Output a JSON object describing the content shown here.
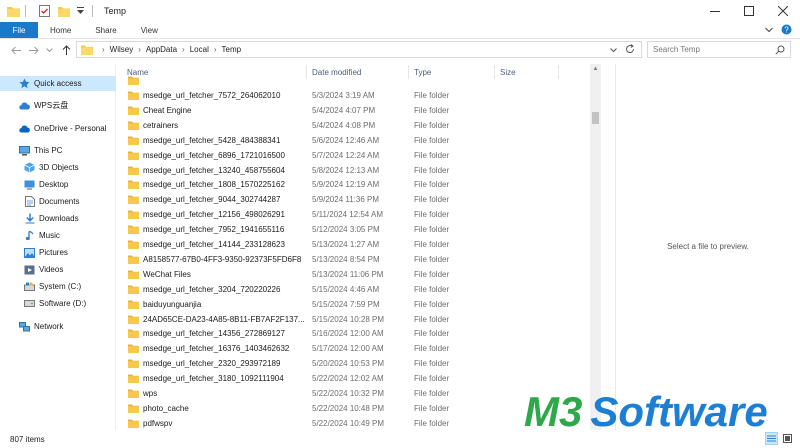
{
  "window": {
    "title": "Temp",
    "minimize_icon": "minimize-icon",
    "maximize_icon": "maximize-icon",
    "close_icon": "close-icon"
  },
  "ribbon": {
    "tabs": [
      {
        "label": "File"
      },
      {
        "label": "Home"
      },
      {
        "label": "Share"
      },
      {
        "label": "View"
      }
    ],
    "accent": "#1979ca"
  },
  "address": {
    "crumbs": [
      "Wilsey",
      "AppData",
      "Local",
      "Temp"
    ]
  },
  "search": {
    "placeholder": "Search Temp"
  },
  "navpane": {
    "quick_access": "Quick access",
    "wps": "WPS云盘",
    "onedrive": "OneDrive - Personal",
    "this_pc": "This PC",
    "items": [
      {
        "label": "3D Objects",
        "icon": "3d-objects-icon"
      },
      {
        "label": "Desktop",
        "icon": "desktop-icon"
      },
      {
        "label": "Documents",
        "icon": "documents-icon"
      },
      {
        "label": "Downloads",
        "icon": "downloads-icon"
      },
      {
        "label": "Music",
        "icon": "music-icon"
      },
      {
        "label": "Pictures",
        "icon": "pictures-icon"
      },
      {
        "label": "Videos",
        "icon": "videos-icon"
      },
      {
        "label": "System (C:)",
        "icon": "drive-c-icon"
      },
      {
        "label": "Software (D:)",
        "icon": "drive-d-icon"
      }
    ],
    "network": "Network"
  },
  "columns": {
    "name": "Name",
    "date": "Date modified",
    "type": "Type",
    "size": "Size"
  },
  "files": [
    {
      "name": "msedge_url_fetcher_7572_264062010",
      "date": "5/3/2024 3:19 AM",
      "type": "File folder"
    },
    {
      "name": "Cheat Engine",
      "date": "5/4/2024 4:07 PM",
      "type": "File folder"
    },
    {
      "name": "cetrainers",
      "date": "5/4/2024 4:08 PM",
      "type": "File folder"
    },
    {
      "name": "msedge_url_fetcher_5428_484388341",
      "date": "5/6/2024 12:46 AM",
      "type": "File folder"
    },
    {
      "name": "msedge_url_fetcher_6896_1721016500",
      "date": "5/7/2024 12:24 AM",
      "type": "File folder"
    },
    {
      "name": "msedge_url_fetcher_13240_458755604",
      "date": "5/8/2024 12:13 AM",
      "type": "File folder"
    },
    {
      "name": "msedge_url_fetcher_1808_1570225162",
      "date": "5/9/2024 12:19 AM",
      "type": "File folder"
    },
    {
      "name": "msedge_url_fetcher_9044_302744287",
      "date": "5/9/2024 11:36 PM",
      "type": "File folder"
    },
    {
      "name": "msedge_url_fetcher_12156_498026291",
      "date": "5/11/2024 12:54 AM",
      "type": "File folder"
    },
    {
      "name": "msedge_url_fetcher_7952_1941655116",
      "date": "5/12/2024 3:05 PM",
      "type": "File folder"
    },
    {
      "name": "msedge_url_fetcher_14144_233128623",
      "date": "5/13/2024 1:27 AM",
      "type": "File folder"
    },
    {
      "name": "A8158577-67B0-4FF3-9350-92373F5FD6F8",
      "date": "5/13/2024 8:54 PM",
      "type": "File folder"
    },
    {
      "name": "WeChat Files",
      "date": "5/13/2024 11:06 PM",
      "type": "File folder"
    },
    {
      "name": "msedge_url_fetcher_3204_720220226",
      "date": "5/15/2024 4:46 AM",
      "type": "File folder"
    },
    {
      "name": "baiduyunguanjia",
      "date": "5/15/2024 7:59 PM",
      "type": "File folder"
    },
    {
      "name": "24AD65CE-DA23-4A85-8B11-FB7AF2F137...",
      "date": "5/15/2024 10:28 PM",
      "type": "File folder"
    },
    {
      "name": "msedge_url_fetcher_14356_272869127",
      "date": "5/16/2024 12:00 AM",
      "type": "File folder"
    },
    {
      "name": "msedge_url_fetcher_16376_1403462632",
      "date": "5/17/2024 12:00 AM",
      "type": "File folder"
    },
    {
      "name": "msedge_url_fetcher_2320_293972189",
      "date": "5/20/2024 10:53 PM",
      "type": "File folder"
    },
    {
      "name": "msedge_url_fetcher_3180_1092111904",
      "date": "5/22/2024 12:02 AM",
      "type": "File folder"
    },
    {
      "name": "wps",
      "date": "5/22/2024 10:32 PM",
      "type": "File folder"
    },
    {
      "name": "photo_cache",
      "date": "5/22/2024 10:48 PM",
      "type": "File folder"
    },
    {
      "name": "pdfwspv",
      "date": "5/22/2024 10:49 PM",
      "type": "File folder"
    }
  ],
  "preview": {
    "message": "Select a file to preview."
  },
  "status": {
    "count": "807 items"
  },
  "watermark": {
    "text": "M3 Software",
    "colors": {
      "m3": "#2ea84a",
      "software": "#1d7fd4"
    }
  },
  "colors": {
    "folder": "#f8c84a",
    "selection": "#cce8ff",
    "column_header": "#4c607a"
  }
}
